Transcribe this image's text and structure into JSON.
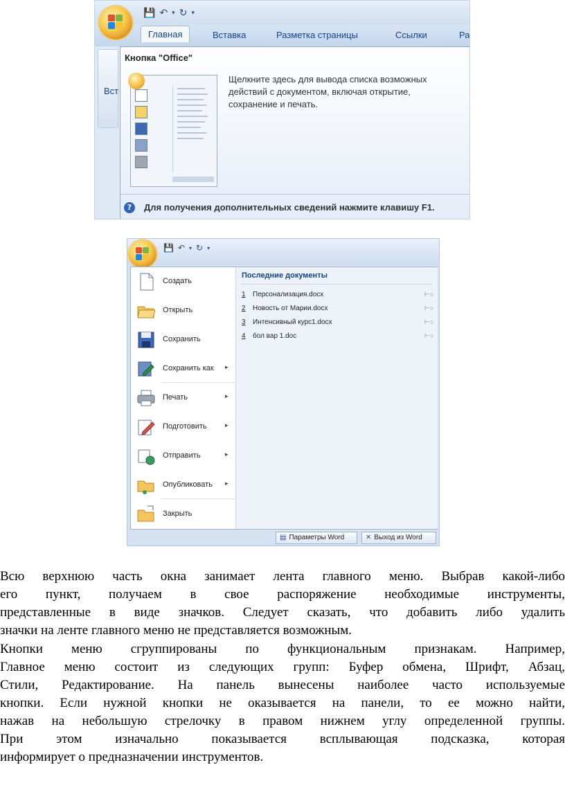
{
  "screenshot1": {
    "tabs": [
      "Главная",
      "Вставка",
      "Разметка страницы",
      "Ссылки",
      "Ра"
    ],
    "ribbon_partial_label": "Вст",
    "tooltip": {
      "title": "Кнопка \"Office\"",
      "body_lines": [
        "Щелкните здесь для вывода списка возможных",
        "действий с документом, включая открытие,",
        "сохранение и печать."
      ],
      "help_text": "Для получения дополнительных сведений нажмите клавишу F1."
    }
  },
  "screenshot2": {
    "menu_items": [
      {
        "label": "Создать",
        "icon": "new-document-icon",
        "submenu": false
      },
      {
        "label": "Открыть",
        "icon": "open-folder-icon",
        "submenu": false
      },
      {
        "label": "Сохранить",
        "icon": "save-disk-icon",
        "submenu": false
      },
      {
        "label": "Сохранить как",
        "icon": "save-as-icon",
        "submenu": true
      },
      {
        "label": "Печать",
        "icon": "printer-icon",
        "submenu": true
      },
      {
        "label": "Подготовить",
        "icon": "prepare-pen-icon",
        "submenu": true
      },
      {
        "label": "Отправить",
        "icon": "send-icon",
        "submenu": true
      },
      {
        "label": "Опубликовать",
        "icon": "publish-folder-icon",
        "submenu": true
      },
      {
        "label": "Закрыть",
        "icon": "close-folder-icon",
        "submenu": false
      }
    ],
    "recent_title": "Последние документы",
    "recent_docs": [
      {
        "num": "1",
        "name": "Персонализация.docx"
      },
      {
        "num": "2",
        "name": "Новость от Марии.docx"
      },
      {
        "num": "3",
        "name": "Интенсивный курс1.docx"
      },
      {
        "num": "4",
        "name": "бол вар 1.doc"
      }
    ],
    "options_button": "Параметры Word",
    "exit_button": "Выход из Word"
  },
  "paragraphs": [
    {
      "lines": [
        "Всю верхнюю часть окна занимает лента главного меню. Выбрав какой-либо",
        "его пункт, получаем в свое распоряжение необходимые инструменты,",
        "представленные в виде значков. Следует сказать, что добавить либо удалить",
        "значки на ленте главного меню не представляется возможным."
      ]
    },
    {
      "lines": [
        "Кнопки меню сгруппированы по функциональным признакам. Например,",
        "Главное меню состоит из следующих групп: Буфер обмена, Шрифт, Абзац,",
        "Стили, Редактирование. На панель вынесены наиболее часто используемые",
        "кнопки. Если нужной кнопки не оказывается на панели, то ее можно найти,",
        "нажав на небольшую стрелочку в правом нижнем углу определенной группы.",
        "При этом изначально показывается всплывающая подсказка, которая",
        "информирует о предназначении инструментов."
      ]
    }
  ]
}
